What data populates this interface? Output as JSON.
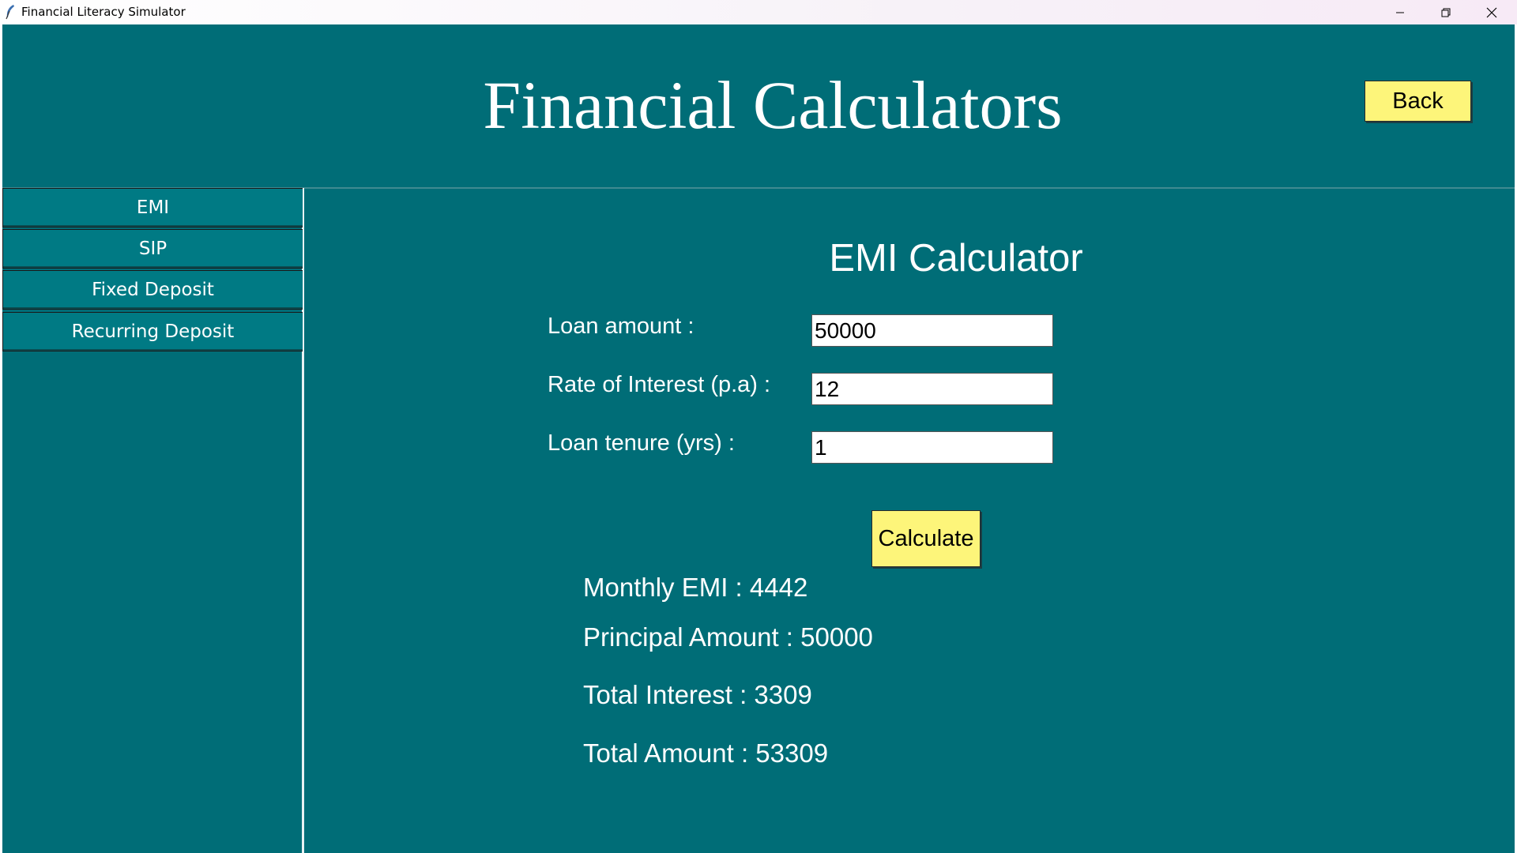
{
  "window": {
    "title": "Financial Literacy Simulator",
    "icons": [
      "feather-icon",
      "minimize-icon",
      "restore-icon",
      "close-icon"
    ]
  },
  "header": {
    "title": "Financial Calculators",
    "back_label": "Back"
  },
  "sidebar": {
    "items": [
      {
        "label": "EMI"
      },
      {
        "label": "SIP"
      },
      {
        "label": "Fixed Deposit"
      },
      {
        "label": "Recurring Deposit"
      }
    ]
  },
  "calculator": {
    "title": "EMI Calculator",
    "fields": [
      {
        "label": "Loan amount :",
        "value": "50000"
      },
      {
        "label": "Rate of Interest (p.a) :",
        "value": "12"
      },
      {
        "label": "Loan tenure (yrs) :",
        "value": "1"
      }
    ],
    "calculate_label": "Calculate",
    "results": [
      "Monthly EMI : 4442",
      "Principal Amount : 50000",
      "Total Interest : 3309",
      "Total Amount : 53309"
    ]
  },
  "colors": {
    "background": "#006d77",
    "sidebar_button": "#007a84",
    "button_yellow": "#fdf57a",
    "text": "#ffffff"
  }
}
